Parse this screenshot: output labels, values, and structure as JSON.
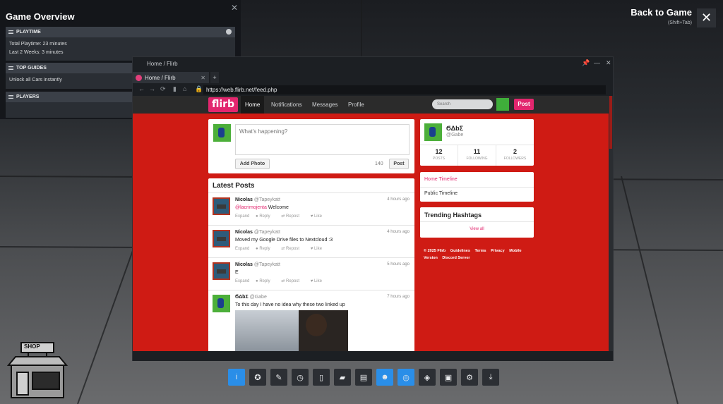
{
  "overview": {
    "title": "Game Overview",
    "sections": {
      "playtime": {
        "header": "PLAYTIME",
        "total": "Total Playtime: 23 minutes",
        "last2": "Last 2 Weeks: 3 minutes"
      },
      "guides": {
        "header": "TOP GUIDES",
        "item": "Unlock all Cars instantly"
      },
      "players": {
        "header": "PLAYERS"
      }
    }
  },
  "back": {
    "label": "Back to Game",
    "shortcut": "(Shift+Tab)"
  },
  "browser": {
    "window_title": "Home / Flirb",
    "tab_label": "Home / Flirb",
    "url": "https://web.flirb.net/feed.php"
  },
  "site": {
    "logo": "flirb",
    "nav": [
      "Home",
      "Notifications",
      "Messages",
      "Profile"
    ],
    "search_placeholder": "Search",
    "post_button": "Post",
    "compose": {
      "placeholder": "What's happening?",
      "add_photo": "Add Photo",
      "counter": "140",
      "post": "Post"
    },
    "latest_posts_title": "Latest Posts",
    "posts": [
      {
        "name": "Nicolas",
        "handle": "@Tapeykatt",
        "time": "4 hours ago",
        "mention": "@lacrimojenta",
        "text": " Welcome"
      },
      {
        "name": "Nicolas",
        "handle": "@Tapeykatt",
        "time": "4 hours ago",
        "mention": "",
        "text": "Moved my Google Drive files to Nextcloud :3"
      },
      {
        "name": "Nicolas",
        "handle": "@Tapeykatt",
        "time": "5 hours ago",
        "mention": "",
        "text": "E"
      },
      {
        "name": "ϬΔbƩ",
        "handle": "@Gabe",
        "time": "7 hours ago",
        "mention": "",
        "text": "To this day I have no idea why these two linked up"
      }
    ],
    "post_actions": [
      "Expand",
      "Reply",
      "Repost",
      "Like"
    ],
    "profile": {
      "name": "ϬΔbƩ",
      "handle": "@Gabe",
      "stats": [
        {
          "value": "12",
          "label": "POSTS"
        },
        {
          "value": "11",
          "label": "FOLLOWING"
        },
        {
          "value": "2",
          "label": "FOLLOWERS"
        }
      ]
    },
    "timelines": [
      "Home Timeline",
      "Public Timeline"
    ],
    "trending": {
      "title": "Trending Hashtags",
      "view_all": "View all"
    },
    "footer": [
      "© 2025 Flirb",
      "Guidelines",
      "Terms",
      "Privacy",
      "Mobile Version",
      "Discord Server"
    ]
  },
  "shop_label": "SHOP",
  "toolbar_icons": [
    "info-icon",
    "achievements-icon",
    "notes-icon",
    "recent-icon",
    "guides-icon",
    "discussions-icon",
    "chat-icon",
    "friends-icon",
    "browser-icon",
    "controller-icon",
    "recording-icon",
    "settings-icon",
    "download-icon"
  ],
  "colors": {
    "accent": "#e2266e",
    "page_bg": "#cf1b14",
    "toolbar_active": "#2a8ee8"
  }
}
